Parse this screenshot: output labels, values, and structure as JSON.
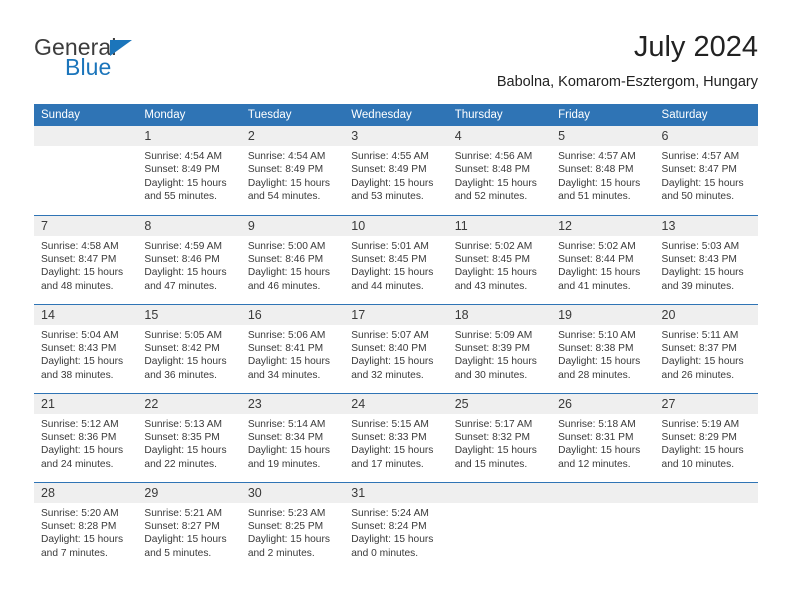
{
  "brand": {
    "name_top": "General",
    "name_bottom": "Blue",
    "triangle_icon": "blue-triangle-icon",
    "color_primary": "#1b75bb",
    "color_text": "#3c3c3c"
  },
  "header": {
    "title": "July 2024",
    "subtitle": "Babolna, Komarom-Esztergom, Hungary"
  },
  "theme": {
    "header_blue": "#2f74b5",
    "daynum_band": "#efefef",
    "text": "#3a3a3a"
  },
  "calendar": {
    "weekday_headers": [
      "Sunday",
      "Monday",
      "Tuesday",
      "Wednesday",
      "Thursday",
      "Friday",
      "Saturday"
    ],
    "labels": {
      "sunrise": "Sunrise:",
      "sunset": "Sunset:",
      "daylight": "Daylight:"
    },
    "weeks": [
      [
        {
          "day": "",
          "empty": true,
          "sunrise": "",
          "sunset": "",
          "daylight_1": "",
          "daylight_2": ""
        },
        {
          "day": "1",
          "sunrise": "Sunrise: 4:54 AM",
          "sunset": "Sunset: 8:49 PM",
          "daylight_1": "Daylight: 15 hours",
          "daylight_2": "and 55 minutes."
        },
        {
          "day": "2",
          "sunrise": "Sunrise: 4:54 AM",
          "sunset": "Sunset: 8:49 PM",
          "daylight_1": "Daylight: 15 hours",
          "daylight_2": "and 54 minutes."
        },
        {
          "day": "3",
          "sunrise": "Sunrise: 4:55 AM",
          "sunset": "Sunset: 8:49 PM",
          "daylight_1": "Daylight: 15 hours",
          "daylight_2": "and 53 minutes."
        },
        {
          "day": "4",
          "sunrise": "Sunrise: 4:56 AM",
          "sunset": "Sunset: 8:48 PM",
          "daylight_1": "Daylight: 15 hours",
          "daylight_2": "and 52 minutes."
        },
        {
          "day": "5",
          "sunrise": "Sunrise: 4:57 AM",
          "sunset": "Sunset: 8:48 PM",
          "daylight_1": "Daylight: 15 hours",
          "daylight_2": "and 51 minutes."
        },
        {
          "day": "6",
          "sunrise": "Sunrise: 4:57 AM",
          "sunset": "Sunset: 8:47 PM",
          "daylight_1": "Daylight: 15 hours",
          "daylight_2": "and 50 minutes."
        }
      ],
      [
        {
          "day": "7",
          "sunrise": "Sunrise: 4:58 AM",
          "sunset": "Sunset: 8:47 PM",
          "daylight_1": "Daylight: 15 hours",
          "daylight_2": "and 48 minutes."
        },
        {
          "day": "8",
          "sunrise": "Sunrise: 4:59 AM",
          "sunset": "Sunset: 8:46 PM",
          "daylight_1": "Daylight: 15 hours",
          "daylight_2": "and 47 minutes."
        },
        {
          "day": "9",
          "sunrise": "Sunrise: 5:00 AM",
          "sunset": "Sunset: 8:46 PM",
          "daylight_1": "Daylight: 15 hours",
          "daylight_2": "and 46 minutes."
        },
        {
          "day": "10",
          "sunrise": "Sunrise: 5:01 AM",
          "sunset": "Sunset: 8:45 PM",
          "daylight_1": "Daylight: 15 hours",
          "daylight_2": "and 44 minutes."
        },
        {
          "day": "11",
          "sunrise": "Sunrise: 5:02 AM",
          "sunset": "Sunset: 8:45 PM",
          "daylight_1": "Daylight: 15 hours",
          "daylight_2": "and 43 minutes."
        },
        {
          "day": "12",
          "sunrise": "Sunrise: 5:02 AM",
          "sunset": "Sunset: 8:44 PM",
          "daylight_1": "Daylight: 15 hours",
          "daylight_2": "and 41 minutes."
        },
        {
          "day": "13",
          "sunrise": "Sunrise: 5:03 AM",
          "sunset": "Sunset: 8:43 PM",
          "daylight_1": "Daylight: 15 hours",
          "daylight_2": "and 39 minutes."
        }
      ],
      [
        {
          "day": "14",
          "sunrise": "Sunrise: 5:04 AM",
          "sunset": "Sunset: 8:43 PM",
          "daylight_1": "Daylight: 15 hours",
          "daylight_2": "and 38 minutes."
        },
        {
          "day": "15",
          "sunrise": "Sunrise: 5:05 AM",
          "sunset": "Sunset: 8:42 PM",
          "daylight_1": "Daylight: 15 hours",
          "daylight_2": "and 36 minutes."
        },
        {
          "day": "16",
          "sunrise": "Sunrise: 5:06 AM",
          "sunset": "Sunset: 8:41 PM",
          "daylight_1": "Daylight: 15 hours",
          "daylight_2": "and 34 minutes."
        },
        {
          "day": "17",
          "sunrise": "Sunrise: 5:07 AM",
          "sunset": "Sunset: 8:40 PM",
          "daylight_1": "Daylight: 15 hours",
          "daylight_2": "and 32 minutes."
        },
        {
          "day": "18",
          "sunrise": "Sunrise: 5:09 AM",
          "sunset": "Sunset: 8:39 PM",
          "daylight_1": "Daylight: 15 hours",
          "daylight_2": "and 30 minutes."
        },
        {
          "day": "19",
          "sunrise": "Sunrise: 5:10 AM",
          "sunset": "Sunset: 8:38 PM",
          "daylight_1": "Daylight: 15 hours",
          "daylight_2": "and 28 minutes."
        },
        {
          "day": "20",
          "sunrise": "Sunrise: 5:11 AM",
          "sunset": "Sunset: 8:37 PM",
          "daylight_1": "Daylight: 15 hours",
          "daylight_2": "and 26 minutes."
        }
      ],
      [
        {
          "day": "21",
          "sunrise": "Sunrise: 5:12 AM",
          "sunset": "Sunset: 8:36 PM",
          "daylight_1": "Daylight: 15 hours",
          "daylight_2": "and 24 minutes."
        },
        {
          "day": "22",
          "sunrise": "Sunrise: 5:13 AM",
          "sunset": "Sunset: 8:35 PM",
          "daylight_1": "Daylight: 15 hours",
          "daylight_2": "and 22 minutes."
        },
        {
          "day": "23",
          "sunrise": "Sunrise: 5:14 AM",
          "sunset": "Sunset: 8:34 PM",
          "daylight_1": "Daylight: 15 hours",
          "daylight_2": "and 19 minutes."
        },
        {
          "day": "24",
          "sunrise": "Sunrise: 5:15 AM",
          "sunset": "Sunset: 8:33 PM",
          "daylight_1": "Daylight: 15 hours",
          "daylight_2": "and 17 minutes."
        },
        {
          "day": "25",
          "sunrise": "Sunrise: 5:17 AM",
          "sunset": "Sunset: 8:32 PM",
          "daylight_1": "Daylight: 15 hours",
          "daylight_2": "and 15 minutes."
        },
        {
          "day": "26",
          "sunrise": "Sunrise: 5:18 AM",
          "sunset": "Sunset: 8:31 PM",
          "daylight_1": "Daylight: 15 hours",
          "daylight_2": "and 12 minutes."
        },
        {
          "day": "27",
          "sunrise": "Sunrise: 5:19 AM",
          "sunset": "Sunset: 8:29 PM",
          "daylight_1": "Daylight: 15 hours",
          "daylight_2": "and 10 minutes."
        }
      ],
      [
        {
          "day": "28",
          "sunrise": "Sunrise: 5:20 AM",
          "sunset": "Sunset: 8:28 PM",
          "daylight_1": "Daylight: 15 hours",
          "daylight_2": "and 7 minutes."
        },
        {
          "day": "29",
          "sunrise": "Sunrise: 5:21 AM",
          "sunset": "Sunset: 8:27 PM",
          "daylight_1": "Daylight: 15 hours",
          "daylight_2": "and 5 minutes."
        },
        {
          "day": "30",
          "sunrise": "Sunrise: 5:23 AM",
          "sunset": "Sunset: 8:25 PM",
          "daylight_1": "Daylight: 15 hours",
          "daylight_2": "and 2 minutes."
        },
        {
          "day": "31",
          "sunrise": "Sunrise: 5:24 AM",
          "sunset": "Sunset: 8:24 PM",
          "daylight_1": "Daylight: 15 hours",
          "daylight_2": "and 0 minutes."
        },
        {
          "day": "",
          "empty": true,
          "sunrise": "",
          "sunset": "",
          "daylight_1": "",
          "daylight_2": ""
        },
        {
          "day": "",
          "empty": true,
          "sunrise": "",
          "sunset": "",
          "daylight_1": "",
          "daylight_2": ""
        },
        {
          "day": "",
          "empty": true,
          "sunrise": "",
          "sunset": "",
          "daylight_1": "",
          "daylight_2": ""
        }
      ]
    ]
  }
}
